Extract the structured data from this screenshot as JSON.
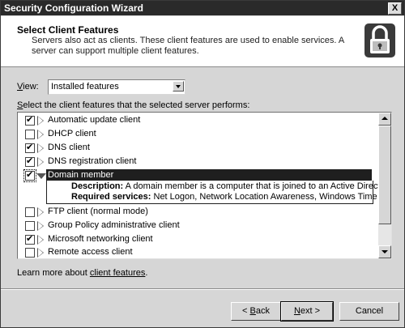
{
  "window": {
    "title": "Security Configuration Wizard",
    "close_label": "X"
  },
  "header": {
    "title": "Select Client Features",
    "description": "Servers also act as clients. These client features are used to enable services. A server can support multiple client features.",
    "icon": "lock-icon"
  },
  "view": {
    "label_prefix": "",
    "label_underlined": "V",
    "label_rest": "iew:",
    "selected": "Installed features"
  },
  "instruction": {
    "underlined": "S",
    "rest": "elect the client features that the selected server performs:"
  },
  "features": [
    {
      "label": "Automatic update client",
      "checked": true
    },
    {
      "label": "DHCP client",
      "checked": false
    },
    {
      "label": "DNS client",
      "checked": true
    },
    {
      "label": "DNS registration client",
      "checked": true
    },
    {
      "label": "Domain member",
      "checked": true,
      "expanded": true
    },
    {
      "label": "FTP client (normal mode)",
      "checked": false
    },
    {
      "label": "Group Policy administrative client",
      "checked": false
    },
    {
      "label": "Microsoft networking client",
      "checked": true
    },
    {
      "label": "Remote access client",
      "checked": false
    }
  ],
  "detail": {
    "description_label": "Description:",
    "description_text": "A domain member is a computer that is joined to an Active Directory domain.",
    "services_label": "Required services:",
    "services_text": "Net Logon, Network Location Awareness, Windows Time"
  },
  "learn_more": {
    "prefix": "Learn more about ",
    "link": "client features",
    "suffix": "."
  },
  "buttons": {
    "back_prefix": "< ",
    "back_underlined": "B",
    "back_rest": "ack",
    "next_underlined": "N",
    "next_rest": "ext >",
    "cancel": "Cancel"
  }
}
